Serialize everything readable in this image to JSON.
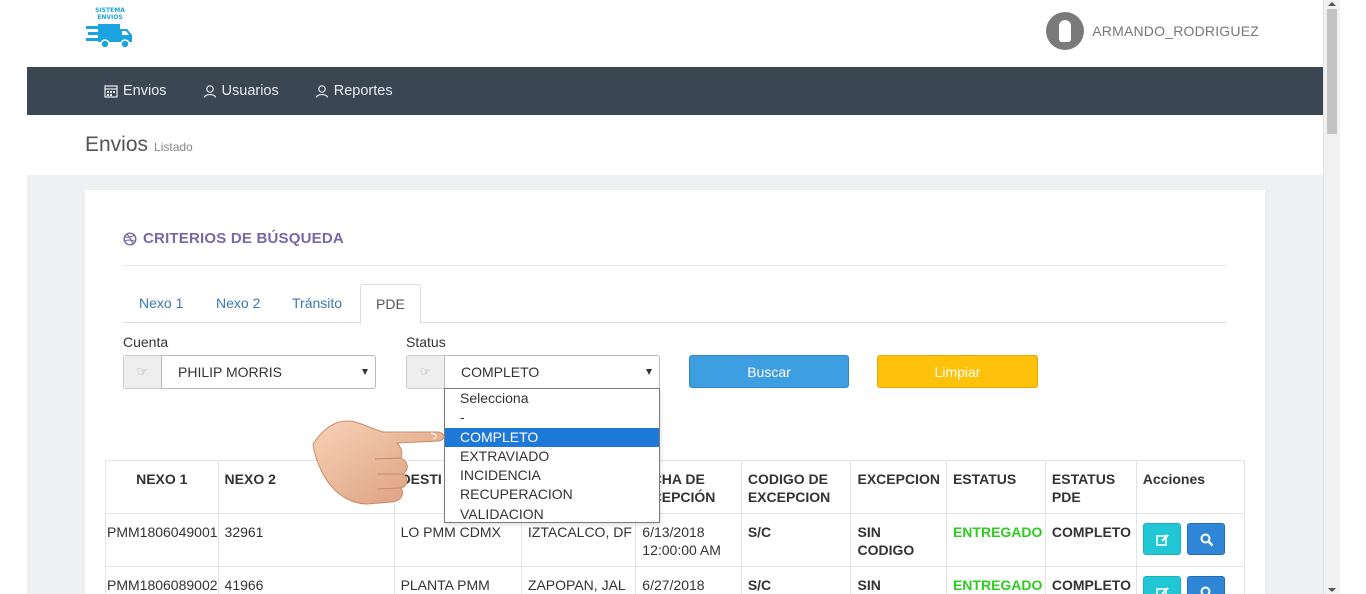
{
  "brand": {
    "line1": "SISTEMA",
    "line2": "ENVIOS",
    "color": "#1aa3e0"
  },
  "user": {
    "name": "ARMANDO_RODRIGUEZ"
  },
  "nav": [
    {
      "label": "Envios",
      "icon": "calendar-icon"
    },
    {
      "label": "Usuarios",
      "icon": "users-icon"
    },
    {
      "label": "Reportes",
      "icon": "users-icon"
    }
  ],
  "page": {
    "title": "Envios",
    "subtitle": "Listado"
  },
  "search": {
    "title": "CRITERIOS DE BÚSQUEDA",
    "tabs": [
      "Nexo 1",
      "Nexo 2",
      "Tránsito",
      "PDE"
    ],
    "active_tab": "PDE",
    "cuenta_label": "Cuenta",
    "cuenta_value": "PHILIP MORRIS",
    "status_label": "Status",
    "status_value": "COMPLETO",
    "status_options": [
      "Selecciona",
      "-",
      "COMPLETO",
      "EXTRAVIADO",
      "INCIDENCIA",
      "RECUPERACION",
      "VALIDACION"
    ],
    "buscar_label": "Buscar",
    "limpiar_label": "Limpiar"
  },
  "table": {
    "headers": [
      "NEXO 1",
      "NEXO 2",
      "DESTINO",
      "",
      "FECHA DE RECEPCIÓN",
      "CODIGO DE EXCEPCION",
      "EXCEPCION",
      "ESTATUS",
      "ESTATUS PDE",
      "Acciones"
    ],
    "header_visible": [
      "NEXO 1",
      "NEXO 2",
      "DESTI",
      "",
      "ECHA DE",
      "ECEPCIÓN",
      "CODIGO DE",
      "EXCEPCION",
      "EXCEPCION",
      "ESTATUS",
      "ESTATUS",
      "PDE",
      "Acciones"
    ],
    "rows": [
      {
        "nexo1": "PMM1806049001",
        "nexo2": "32961",
        "destino": "LO PMM CDMX",
        "ciudad": "IZTACALCO, DF",
        "fecha1": "6/13/2018",
        "fecha2": "12:00:00 AM",
        "codigo": "S/C",
        "exc1": "SIN",
        "exc2": "CODIGO",
        "estatus": "ENTREGADO",
        "pde": "COMPLETO"
      },
      {
        "nexo1": "PMM1806089002",
        "nexo2": "41966",
        "destino": "PLANTA PMM",
        "ciudad": "ZAPOPAN, JAL",
        "fecha1": "6/27/2018",
        "fecha2": "",
        "codigo": "S/C",
        "exc1": "SIN",
        "exc2": "",
        "estatus": "ENTREGADO",
        "pde": "COMPLETO"
      }
    ]
  },
  "colors": {
    "navbar": "#3a4652",
    "accent_purple": "#7a67a8",
    "buscar": "#3e9ee2",
    "limpiar": "#ffc20a",
    "entregado": "#2ecc1f",
    "dropdown_selected": "#1e78d8"
  }
}
